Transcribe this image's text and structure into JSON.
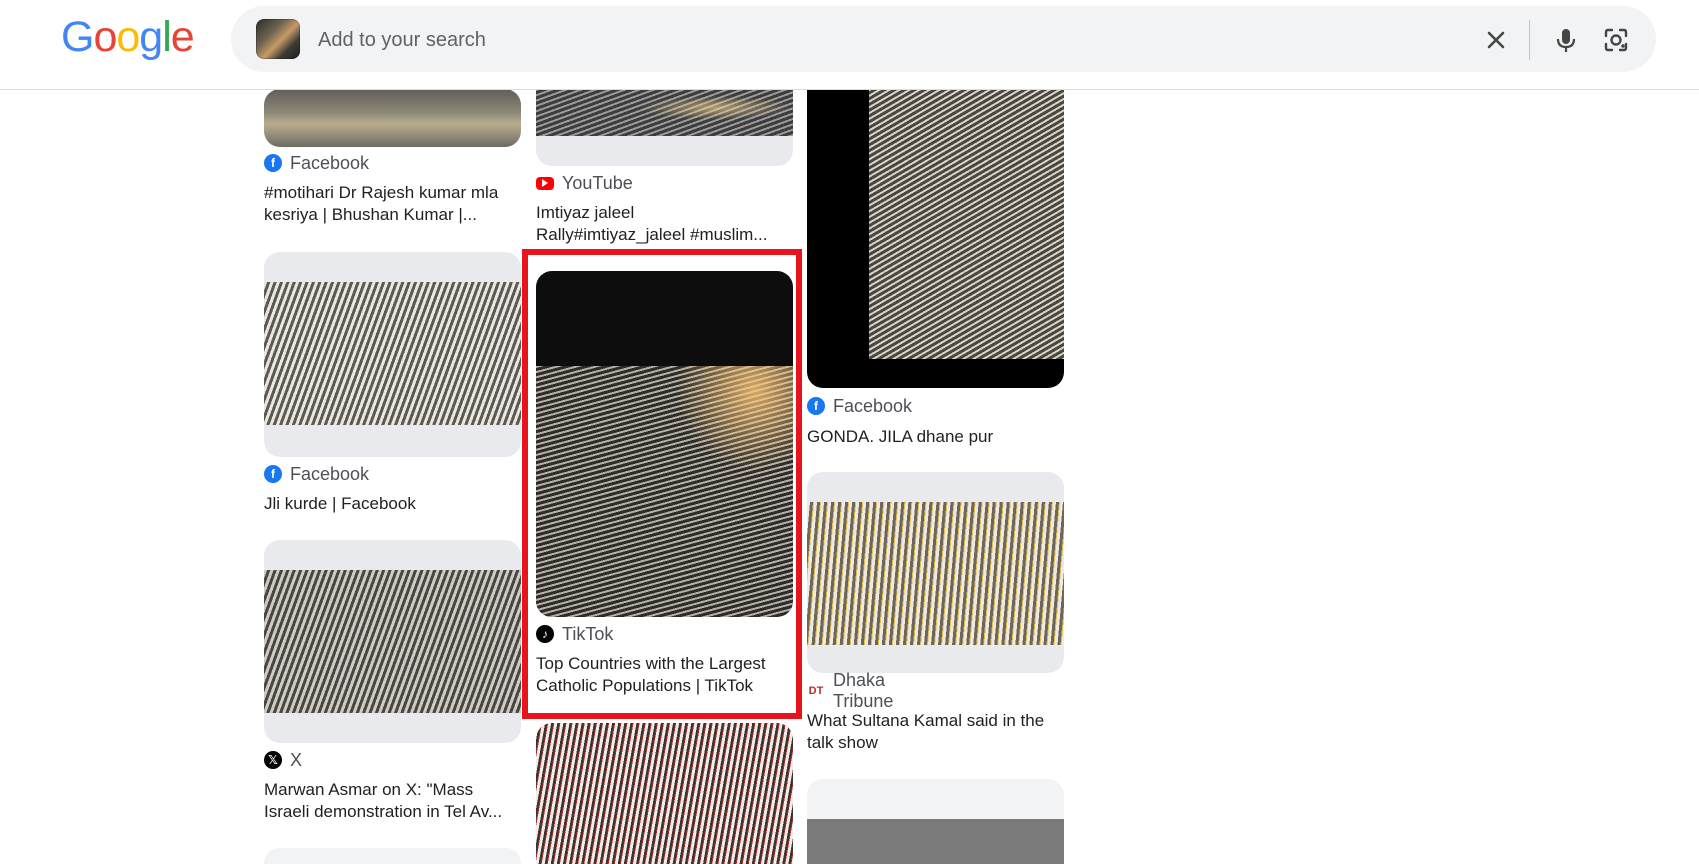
{
  "header": {
    "logo_letters": [
      {
        "char": "G",
        "color": "#4285F4"
      },
      {
        "char": "o",
        "color": "#EA4335"
      },
      {
        "char": "o",
        "color": "#FBBC05"
      },
      {
        "char": "g",
        "color": "#4285F4"
      },
      {
        "char": "l",
        "color": "#34A853"
      },
      {
        "char": "e",
        "color": "#EA4335"
      }
    ],
    "search_placeholder": "Add to your search",
    "icons": {
      "close": "close-icon",
      "mic": "mic-icon",
      "lens": "lens-icon"
    }
  },
  "results": [
    {
      "source": "Facebook",
      "icon": "facebook-icon",
      "title_line1": "#motihari Dr Rajesh kumar mla",
      "title_line2": "kesriya | Bhushan Kumar |..."
    },
    {
      "source": "YouTube",
      "icon": "youtube-icon",
      "title_line1": "Imtiyaz jaleel",
      "title_line2": "Rally#imtiyaz_jaleel #muslim..."
    },
    {
      "source": "Facebook",
      "icon": "facebook-icon",
      "title_line1": "GONDA. JILA dhane pur",
      "title_line2": ""
    },
    {
      "source": "Facebook",
      "icon": "facebook-icon",
      "title_line1": "Jli kurde | Facebook",
      "title_line2": ""
    },
    {
      "source": "TikTok",
      "icon": "tiktok-icon",
      "title_line1": "Top Countries with the Largest",
      "title_line2": "Catholic Populations | TikTok"
    },
    {
      "source": "Dhaka Tribune",
      "icon": "dhaka-tribune-icon",
      "title_line1": "What Sultana Kamal said in the",
      "title_line2": "talk show"
    },
    {
      "source": "X",
      "icon": "x-icon",
      "title_line1": "Marwan Asmar on X: \"Mass",
      "title_line2": "Israeli demonstration in Tel Av..."
    }
  ],
  "colors": {
    "highlight": "#e8141d",
    "facebook": "#1877F2",
    "youtube": "#FF0000",
    "tiktok": "#000000",
    "x": "#000000",
    "dhaka": "#c62828"
  }
}
